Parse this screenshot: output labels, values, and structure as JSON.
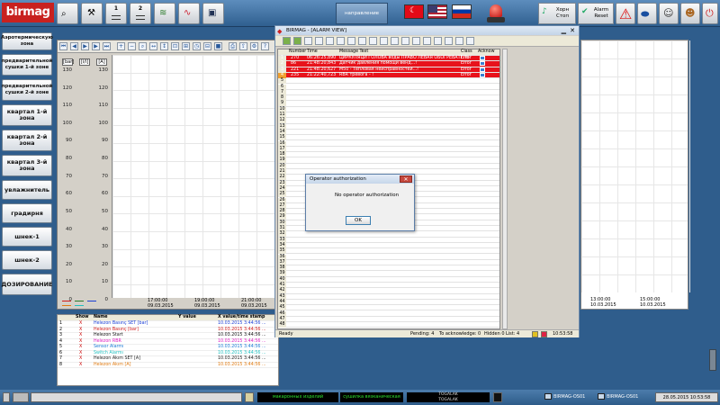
{
  "topbar": {
    "logo": "birmag",
    "toolbar_buttons": [
      {
        "name": "binoculars-icon"
      },
      {
        "name": "person-tool-icon"
      },
      {
        "label": "1"
      },
      {
        "label": "2"
      },
      {
        "name": "chart-line-icon"
      },
      {
        "name": "trend-icon"
      },
      {
        "name": "monitor-icon"
      }
    ],
    "direction_label": "направление",
    "language_flags": [
      "turkey-flag-icon",
      "usa-flag-icon",
      "russia-flag-icon"
    ],
    "right_buttons": [
      {
        "label": "Хорн Стоп"
      },
      {
        "label": "Alarm Reset"
      }
    ]
  },
  "sidebar": {
    "items": [
      {
        "label": "Аэротермическую зона"
      },
      {
        "label": "предварительной сушки 1-й зоне"
      },
      {
        "label": "предварительной сушки 2-й зоне"
      },
      {
        "label": "квартал 1-й зона"
      },
      {
        "label": "квартал 2-й зона"
      },
      {
        "label": "квартал 3-й зона"
      },
      {
        "label": "увлажнитель"
      },
      {
        "label": "градирня"
      },
      {
        "label": "шнек-1"
      },
      {
        "label": "шнек-2"
      },
      {
        "label": "ДОЗИРОВАНИЕ"
      }
    ]
  },
  "trend": {
    "units": [
      "[bar]",
      "[l/l]",
      "[A]"
    ],
    "y_ticks": [
      "130",
      "120",
      "110",
      "100",
      "90",
      "80",
      "70",
      "60",
      "50",
      "40",
      "30",
      "20",
      "10",
      "0"
    ],
    "time_axis": [
      {
        "time": "17:00:00",
        "date": "09.03.2015"
      },
      {
        "time": "19:00:00",
        "date": "09.03.2015"
      },
      {
        "time": "21:00:00",
        "date": "09.03.2015"
      },
      {
        "time": "23:0",
        "date": "09.03.2015"
      }
    ],
    "right_time_axis": [
      {
        "time": "13:00:00",
        "date": "10.03.2015"
      },
      {
        "time": "15:00:00",
        "date": "10.03.2015"
      }
    ],
    "legend_table": {
      "headers": [
        "Show",
        "Name",
        "Y value",
        "X value/time stamp"
      ],
      "rows": [
        {
          "idx": "1",
          "show": "X",
          "name": "Helezon Basınç SET [bar]",
          "xval": "10.03.2015 3:44:56 ...",
          "color": "#1a3fd6"
        },
        {
          "idx": "2",
          "show": "X",
          "name": "Helezon Basınç [bar]",
          "xval": "10.03.2015 3:44:56 ...",
          "color": "#d01b1b"
        },
        {
          "idx": "3",
          "show": "X",
          "name": "Helezon Start",
          "xval": "10.03.2015 3:44:56 ...",
          "color": "#111111"
        },
        {
          "idx": "4",
          "show": "X",
          "name": "Helezon RBR",
          "xval": "10.03.2015 3:44:56 ...",
          "color": "#e020c0"
        },
        {
          "idx": "5",
          "show": "X",
          "name": "Sensor Alarmı",
          "xval": "10.03.2015 3:44:56 ...",
          "color": "#1a7ad6"
        },
        {
          "idx": "6",
          "show": "X",
          "name": "Switch Alarmı",
          "xval": "10.03.2015 3:44:56 ...",
          "color": "#20c0c0"
        },
        {
          "idx": "7",
          "show": "X",
          "name": "Helezon Akım SET [A]",
          "xval": "10.03.2015 3:44:56 ...",
          "color": "#222222"
        },
        {
          "idx": "8",
          "show": "X",
          "name": "Helezon Akım [A]",
          "xval": "10.03.2015 3:44:56 ...",
          "color": "#e07a10"
        }
      ]
    }
  },
  "alarm_view": {
    "title": "BIRMAG - [ALARM VIEW]",
    "headers": [
      "Number",
      "Time",
      "Message Text",
      "Class",
      "Acknow"
    ],
    "alarms": [
      {
        "idx": "1",
        "number": "270",
        "time": "06:26:25,890",
        "text": "ЦИРКУЛЯЦИ ГОЛОВА воды ПРАВО ЛЕВАЯ ОБОГРЕВАТЕЛЬ",
        "class": "Error"
      },
      {
        "idx": "2",
        "number": "86",
        "time": "21:48:20,843",
        "text": "Датчик давления помощи венд...!",
        "class": "Error"
      },
      {
        "idx": "3",
        "number": "221",
        "time": "21:48:20,627",
        "text": "М50 - Тепловая неисправностей...!",
        "class": "Error"
      },
      {
        "idx": "4",
        "number": "235",
        "time": "21:22:40,723",
        "text": "RBR тревога - !",
        "class": "Error"
      }
    ],
    "row_numbers": [
      "1",
      "2",
      "3",
      "4",
      "5",
      "6",
      "7",
      "8",
      "9",
      "10",
      "11",
      "12",
      "13",
      "14",
      "15",
      "16",
      "17",
      "18",
      "19",
      "20",
      "21",
      "22",
      "23",
      "24",
      "25",
      "26",
      "27",
      "28",
      "29",
      "30",
      "31",
      "32",
      "33",
      "34",
      "35",
      "36",
      "37",
      "38",
      "39",
      "40",
      "41",
      "42",
      "43",
      "44",
      "45",
      "46",
      "47",
      "48"
    ],
    "status": {
      "ready": "Ready",
      "pending": "Pending: 4",
      "to_ack": "To acknowledge: 0",
      "hidden": "Hidden 0",
      "list": "List: 4",
      "clock": "10:53:58"
    },
    "error_color": "#e8121b"
  },
  "dialog": {
    "title": "Operator authorization",
    "message": "No operator authorization",
    "ok": "OK"
  },
  "bottombar": {
    "msg1": "макаронных изделий",
    "msg2": "сушилка вязканическая",
    "msg3a": "TOGALAK",
    "msg3b": "TOGALAK",
    "station1": "BIRMAG-OS01",
    "station2": "BIRMAG-OS01",
    "datetime": "28.05.2015 10:53:58"
  }
}
